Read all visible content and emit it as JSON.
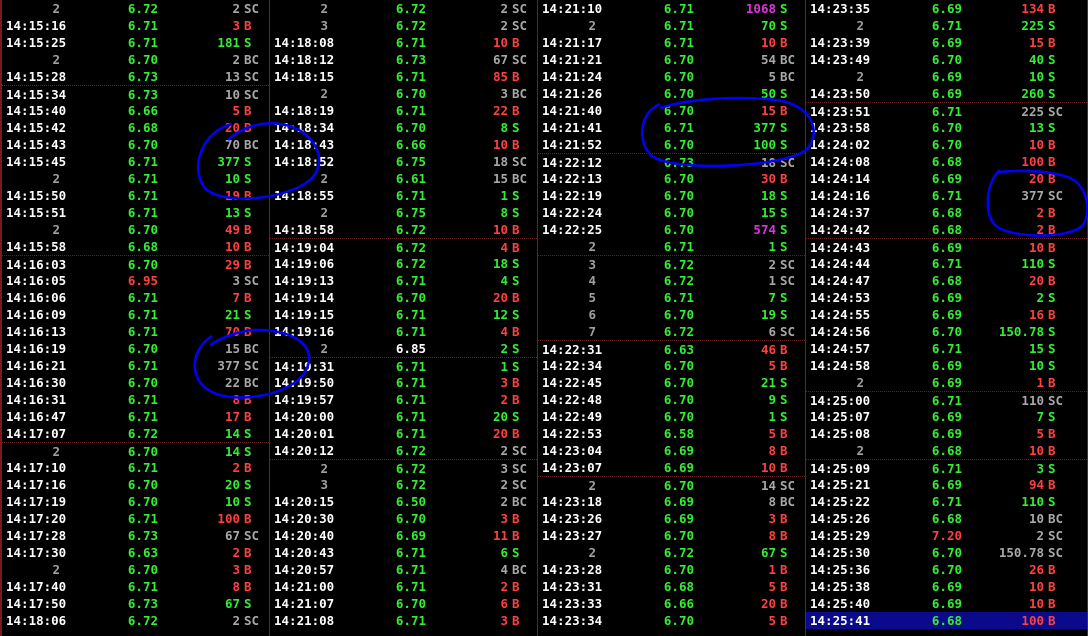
{
  "colors": {
    "background": "#000000",
    "time": "#ffffff",
    "up": "#33ee33",
    "down": "#ff4040",
    "neutral": "#a8a8a8",
    "large_volume": "#dd33dd",
    "highlight_row": "#0a0a8a",
    "annotation_ink": "#0000ff"
  },
  "columns": [
    [
      [
        "2",
        "6.72",
        "g",
        "2",
        "gy",
        "SC",
        "gy"
      ],
      [
        "14:15:16",
        "6.71",
        "g",
        "3",
        "r",
        "B",
        "r"
      ],
      [
        "14:15:25",
        "6.71",
        "g",
        "181",
        "g",
        "S",
        "g"
      ],
      [
        "2",
        "6.70",
        "g",
        "2",
        "gy",
        "BC",
        "gy"
      ],
      [
        "14:15:28",
        "6.73",
        "g",
        "13",
        "gy",
        "SC",
        "gy"
      ],
      [
        "14:15:34",
        "6.73",
        "g",
        "10",
        "gy",
        "SC",
        "gy"
      ],
      [
        "14:15:40",
        "6.66",
        "g",
        "5",
        "r",
        "B",
        "r"
      ],
      [
        "14:15:42",
        "6.68",
        "g",
        "20",
        "r",
        "B",
        "r"
      ],
      [
        "14:15:43",
        "6.70",
        "g",
        "70",
        "gy",
        "BC",
        "gy"
      ],
      [
        "14:15:45",
        "6.71",
        "g",
        "377",
        "g",
        "S",
        "g"
      ],
      [
        "2",
        "6.71",
        "g",
        "10",
        "g",
        "S",
        "g"
      ],
      [
        "14:15:50",
        "6.71",
        "g",
        "19",
        "r",
        "B",
        "r"
      ],
      [
        "14:15:51",
        "6.71",
        "g",
        "13",
        "g",
        "S",
        "g"
      ],
      [
        "2",
        "6.70",
        "g",
        "49",
        "r",
        "B",
        "r"
      ],
      [
        "14:15:58",
        "6.68",
        "g",
        "10",
        "r",
        "B",
        "r"
      ],
      [
        "14:16:03",
        "6.70",
        "g",
        "29",
        "r",
        "B",
        "r"
      ],
      [
        "14:16:05",
        "6.95",
        "r",
        "3",
        "gy",
        "SC",
        "gy"
      ],
      [
        "14:16:06",
        "6.71",
        "g",
        "7",
        "r",
        "B",
        "r"
      ],
      [
        "14:16:09",
        "6.71",
        "g",
        "21",
        "g",
        "S",
        "g"
      ],
      [
        "14:16:13",
        "6.71",
        "g",
        "70",
        "r",
        "B",
        "r"
      ],
      [
        "14:16:19",
        "6.70",
        "g",
        "15",
        "gy",
        "BC",
        "gy"
      ],
      [
        "14:16:21",
        "6.71",
        "g",
        "377",
        "gy",
        "SC",
        "gy"
      ],
      [
        "14:16:30",
        "6.70",
        "g",
        "22",
        "gy",
        "BC",
        "gy"
      ],
      [
        "14:16:31",
        "6.71",
        "g",
        "8",
        "r",
        "B",
        "r"
      ],
      [
        "14:16:47",
        "6.71",
        "g",
        "17",
        "r",
        "B",
        "r"
      ],
      [
        "14:17:07",
        "6.72",
        "g",
        "14",
        "g",
        "S",
        "g"
      ],
      [
        "2",
        "6.70",
        "g",
        "14",
        "g",
        "S",
        "g"
      ],
      [
        "14:17:10",
        "6.71",
        "g",
        "2",
        "r",
        "B",
        "r"
      ],
      [
        "14:17:16",
        "6.70",
        "g",
        "20",
        "g",
        "S",
        "g"
      ],
      [
        "14:17:19",
        "6.70",
        "g",
        "10",
        "g",
        "S",
        "g"
      ],
      [
        "14:17:20",
        "6.71",
        "g",
        "100",
        "r",
        "B",
        "r"
      ],
      [
        "14:17:28",
        "6.73",
        "g",
        "67",
        "gy",
        "SC",
        "gy"
      ],
      [
        "14:17:30",
        "6.63",
        "g",
        "2",
        "r",
        "B",
        "r"
      ],
      [
        "2",
        "6.70",
        "g",
        "3",
        "r",
        "B",
        "r"
      ],
      [
        "14:17:40",
        "6.71",
        "g",
        "8",
        "r",
        "B",
        "r"
      ],
      [
        "14:17:50",
        "6.73",
        "g",
        "67",
        "g",
        "S",
        "g"
      ],
      [
        "14:18:06",
        "6.72",
        "g",
        "2",
        "gy",
        "SC",
        "gy"
      ]
    ],
    [
      [
        "2",
        "6.72",
        "g",
        "2",
        "gy",
        "SC",
        "gy"
      ],
      [
        "3",
        "6.72",
        "g",
        "2",
        "gy",
        "SC",
        "gy"
      ],
      [
        "14:18:08",
        "6.71",
        "g",
        "10",
        "r",
        "B",
        "r"
      ],
      [
        "14:18:12",
        "6.73",
        "g",
        "67",
        "gy",
        "SC",
        "gy"
      ],
      [
        "14:18:15",
        "6.71",
        "g",
        "85",
        "r",
        "B",
        "r"
      ],
      [
        "2",
        "6.70",
        "g",
        "3",
        "gy",
        "BC",
        "gy"
      ],
      [
        "14:18:19",
        "6.71",
        "g",
        "22",
        "r",
        "B",
        "r"
      ],
      [
        "14:18:34",
        "6.70",
        "g",
        "8",
        "g",
        "S",
        "g"
      ],
      [
        "14:18:43",
        "6.66",
        "g",
        "10",
        "r",
        "B",
        "r"
      ],
      [
        "14:18:52",
        "6.75",
        "g",
        "18",
        "gy",
        "SC",
        "gy"
      ],
      [
        "2",
        "6.61",
        "g",
        "15",
        "gy",
        "BC",
        "gy"
      ],
      [
        "14:18:55",
        "6.71",
        "g",
        "1",
        "g",
        "S",
        "g"
      ],
      [
        "2",
        "6.75",
        "g",
        "8",
        "g",
        "S",
        "g"
      ],
      [
        "14:18:58",
        "6.72",
        "g",
        "10",
        "r",
        "B",
        "r"
      ],
      [
        "14:19:04",
        "6.72",
        "g",
        "4",
        "r",
        "B",
        "r"
      ],
      [
        "14:19:06",
        "6.72",
        "g",
        "18",
        "g",
        "S",
        "g"
      ],
      [
        "14:19:13",
        "6.71",
        "g",
        "4",
        "g",
        "S",
        "g"
      ],
      [
        "14:19:14",
        "6.70",
        "g",
        "20",
        "r",
        "B",
        "r"
      ],
      [
        "14:19:15",
        "6.71",
        "g",
        "12",
        "g",
        "S",
        "g"
      ],
      [
        "14:19:16",
        "6.71",
        "g",
        "4",
        "r",
        "B",
        "r"
      ],
      [
        "2",
        "6.85",
        "w",
        "2",
        "g",
        "S",
        "g"
      ],
      [
        "14:19:31",
        "6.71",
        "g",
        "1",
        "g",
        "S",
        "g"
      ],
      [
        "14:19:50",
        "6.71",
        "g",
        "3",
        "r",
        "B",
        "r"
      ],
      [
        "14:19:57",
        "6.71",
        "g",
        "2",
        "r",
        "B",
        "r"
      ],
      [
        "14:20:00",
        "6.71",
        "g",
        "20",
        "g",
        "S",
        "g"
      ],
      [
        "14:20:01",
        "6.71",
        "g",
        "20",
        "r",
        "B",
        "r"
      ],
      [
        "14:20:12",
        "6.72",
        "g",
        "2",
        "gy",
        "SC",
        "gy"
      ],
      [
        "2",
        "6.72",
        "g",
        "3",
        "gy",
        "SC",
        "gy"
      ],
      [
        "3",
        "6.72",
        "g",
        "2",
        "gy",
        "SC",
        "gy"
      ],
      [
        "14:20:15",
        "6.50",
        "g",
        "2",
        "gy",
        "BC",
        "gy"
      ],
      [
        "14:20:30",
        "6.70",
        "g",
        "3",
        "r",
        "B",
        "r"
      ],
      [
        "14:20:40",
        "6.69",
        "g",
        "11",
        "r",
        "B",
        "r"
      ],
      [
        "14:20:43",
        "6.71",
        "g",
        "6",
        "g",
        "S",
        "g"
      ],
      [
        "14:20:57",
        "6.71",
        "g",
        "4",
        "gy",
        "BC",
        "gy"
      ],
      [
        "14:21:00",
        "6.71",
        "g",
        "2",
        "r",
        "B",
        "r"
      ],
      [
        "14:21:07",
        "6.70",
        "g",
        "6",
        "r",
        "B",
        "r"
      ],
      [
        "14:21:08",
        "6.71",
        "g",
        "3",
        "r",
        "B",
        "r"
      ]
    ],
    [
      [
        "14:21:10",
        "6.71",
        "g",
        "1068",
        "m",
        "S",
        "g"
      ],
      [
        "2",
        "6.71",
        "g",
        "70",
        "g",
        "S",
        "g"
      ],
      [
        "14:21:17",
        "6.71",
        "g",
        "10",
        "r",
        "B",
        "r"
      ],
      [
        "14:21:21",
        "6.70",
        "g",
        "54",
        "gy",
        "BC",
        "gy"
      ],
      [
        "14:21:24",
        "6.70",
        "g",
        "5",
        "gy",
        "BC",
        "gy"
      ],
      [
        "14:21:26",
        "6.70",
        "g",
        "50",
        "g",
        "S",
        "g"
      ],
      [
        "14:21:40",
        "6.70",
        "g",
        "15",
        "r",
        "B",
        "r"
      ],
      [
        "14:21:41",
        "6.71",
        "g",
        "377",
        "g",
        "S",
        "g"
      ],
      [
        "14:21:52",
        "6.70",
        "g",
        "100",
        "g",
        "S",
        "g"
      ],
      [
        "14:22:12",
        "6.73",
        "g",
        "18",
        "gy",
        "SC",
        "gy"
      ],
      [
        "14:22:13",
        "6.70",
        "g",
        "30",
        "r",
        "B",
        "r"
      ],
      [
        "14:22:19",
        "6.70",
        "g",
        "18",
        "g",
        "S",
        "g"
      ],
      [
        "14:22:24",
        "6.70",
        "g",
        "15",
        "g",
        "S",
        "g"
      ],
      [
        "14:22:25",
        "6.70",
        "g",
        "574",
        "m",
        "S",
        "g"
      ],
      [
        "2",
        "6.71",
        "g",
        "1",
        "g",
        "S",
        "g"
      ],
      [
        "3",
        "6.72",
        "g",
        "2",
        "gy",
        "SC",
        "gy"
      ],
      [
        "4",
        "6.72",
        "g",
        "1",
        "gy",
        "SC",
        "gy"
      ],
      [
        "5",
        "6.71",
        "g",
        "7",
        "g",
        "S",
        "g"
      ],
      [
        "6",
        "6.70",
        "g",
        "19",
        "g",
        "S",
        "g"
      ],
      [
        "7",
        "6.72",
        "g",
        "6",
        "gy",
        "SC",
        "gy"
      ],
      [
        "14:22:31",
        "6.63",
        "g",
        "46",
        "r",
        "B",
        "r"
      ],
      [
        "14:22:34",
        "6.70",
        "g",
        "5",
        "r",
        "B",
        "r"
      ],
      [
        "14:22:45",
        "6.70",
        "g",
        "21",
        "g",
        "S",
        "g"
      ],
      [
        "14:22:48",
        "6.70",
        "g",
        "9",
        "g",
        "S",
        "g"
      ],
      [
        "14:22:49",
        "6.70",
        "g",
        "1",
        "g",
        "S",
        "g"
      ],
      [
        "14:22:53",
        "6.58",
        "g",
        "5",
        "r",
        "B",
        "r"
      ],
      [
        "14:23:04",
        "6.69",
        "g",
        "8",
        "r",
        "B",
        "r"
      ],
      [
        "14:23:07",
        "6.69",
        "g",
        "10",
        "r",
        "B",
        "r"
      ],
      [
        "2",
        "6.70",
        "g",
        "14",
        "gy",
        "SC",
        "gy"
      ],
      [
        "14:23:18",
        "6.69",
        "g",
        "8",
        "gy",
        "BC",
        "gy"
      ],
      [
        "14:23:26",
        "6.69",
        "g",
        "3",
        "r",
        "B",
        "r"
      ],
      [
        "14:23:27",
        "6.70",
        "g",
        "8",
        "r",
        "B",
        "r"
      ],
      [
        "2",
        "6.72",
        "g",
        "67",
        "g",
        "S",
        "g"
      ],
      [
        "14:23:28",
        "6.70",
        "g",
        "1",
        "r",
        "B",
        "r"
      ],
      [
        "14:23:31",
        "6.68",
        "g",
        "5",
        "r",
        "B",
        "r"
      ],
      [
        "14:23:33",
        "6.66",
        "g",
        "20",
        "r",
        "B",
        "r"
      ],
      [
        "14:23:34",
        "6.70",
        "g",
        "5",
        "r",
        "B",
        "r"
      ]
    ],
    [
      [
        "14:23:35",
        "6.69",
        "g",
        "134",
        "r",
        "B",
        "r"
      ],
      [
        "2",
        "6.71",
        "g",
        "225",
        "g",
        "S",
        "g"
      ],
      [
        "14:23:39",
        "6.69",
        "g",
        "15",
        "r",
        "B",
        "r"
      ],
      [
        "14:23:49",
        "6.70",
        "g",
        "40",
        "g",
        "S",
        "g"
      ],
      [
        "2",
        "6.69",
        "g",
        "10",
        "g",
        "S",
        "g"
      ],
      [
        "14:23:50",
        "6.69",
        "g",
        "260",
        "g",
        "S",
        "g"
      ],
      [
        "14:23:51",
        "6.71",
        "g",
        "225",
        "gy",
        "SC",
        "gy"
      ],
      [
        "14:23:58",
        "6.70",
        "g",
        "13",
        "g",
        "S",
        "g"
      ],
      [
        "14:24:02",
        "6.70",
        "g",
        "10",
        "r",
        "B",
        "r"
      ],
      [
        "14:24:08",
        "6.68",
        "g",
        "100",
        "r",
        "B",
        "r"
      ],
      [
        "14:24:14",
        "6.69",
        "g",
        "20",
        "r",
        "B",
        "r"
      ],
      [
        "14:24:16",
        "6.71",
        "g",
        "377",
        "gy",
        "SC",
        "gy"
      ],
      [
        "14:24:37",
        "6.68",
        "g",
        "2",
        "r",
        "B",
        "r"
      ],
      [
        "14:24:42",
        "6.68",
        "g",
        "2",
        "r",
        "B",
        "r"
      ],
      [
        "14:24:43",
        "6.69",
        "g",
        "10",
        "r",
        "B",
        "r"
      ],
      [
        "14:24:44",
        "6.71",
        "g",
        "110",
        "g",
        "S",
        "g"
      ],
      [
        "14:24:47",
        "6.68",
        "g",
        "20",
        "r",
        "B",
        "r"
      ],
      [
        "14:24:53",
        "6.69",
        "g",
        "2",
        "g",
        "S",
        "g"
      ],
      [
        "14:24:55",
        "6.69",
        "g",
        "16",
        "r",
        "B",
        "r"
      ],
      [
        "14:24:56",
        "6.70",
        "g",
        "150.78",
        "g",
        "S",
        "g"
      ],
      [
        "14:24:57",
        "6.71",
        "g",
        "15",
        "g",
        "S",
        "g"
      ],
      [
        "14:24:58",
        "6.69",
        "g",
        "10",
        "g",
        "S",
        "g"
      ],
      [
        "2",
        "6.69",
        "g",
        "1",
        "r",
        "B",
        "r"
      ],
      [
        "14:25:00",
        "6.71",
        "g",
        "110",
        "gy",
        "SC",
        "gy"
      ],
      [
        "14:25:07",
        "6.69",
        "g",
        "7",
        "g",
        "S",
        "g"
      ],
      [
        "14:25:08",
        "6.69",
        "g",
        "5",
        "r",
        "B",
        "r"
      ],
      [
        "2",
        "6.68",
        "g",
        "10",
        "r",
        "B",
        "r"
      ],
      [
        "14:25:09",
        "6.71",
        "g",
        "3",
        "g",
        "S",
        "g"
      ],
      [
        "14:25:21",
        "6.69",
        "g",
        "94",
        "r",
        "B",
        "r"
      ],
      [
        "14:25:22",
        "6.71",
        "g",
        "110",
        "g",
        "S",
        "g"
      ],
      [
        "14:25:26",
        "6.68",
        "g",
        "10",
        "gy",
        "BC",
        "gy"
      ],
      [
        "14:25:29",
        "7.20",
        "r",
        "2",
        "gy",
        "SC",
        "gy"
      ],
      [
        "14:25:30",
        "6.70",
        "g",
        "150.78",
        "gy",
        "SC",
        "gy"
      ],
      [
        "14:25:36",
        "6.70",
        "g",
        "26",
        "r",
        "B",
        "r"
      ],
      [
        "14:25:38",
        "6.69",
        "g",
        "10",
        "r",
        "B",
        "r"
      ],
      [
        "14:25:40",
        "6.69",
        "g",
        "10",
        "r",
        "B",
        "r"
      ],
      [
        "14:25:41",
        "6.68",
        "g",
        "100",
        "r",
        "B",
        "r"
      ]
    ]
  ]
}
